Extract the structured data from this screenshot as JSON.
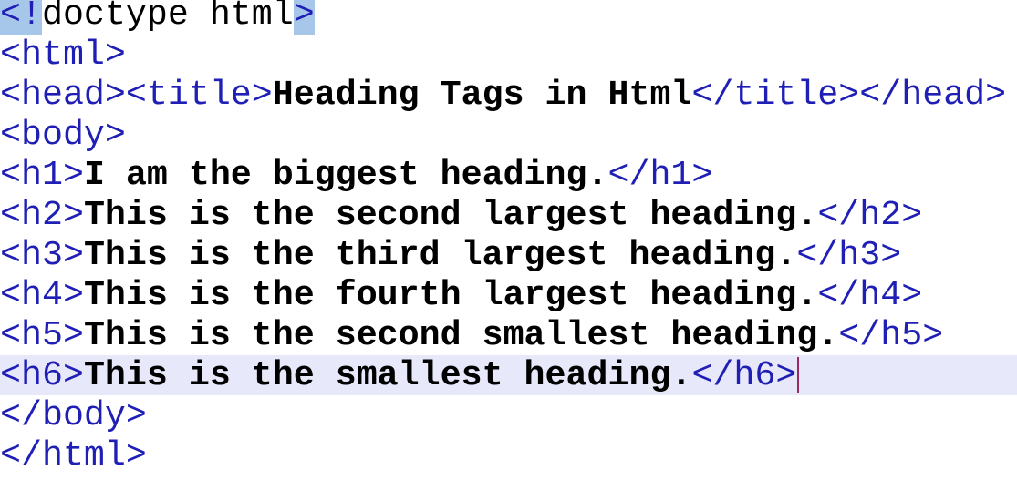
{
  "lines": [
    [
      {
        "t": "<!",
        "c": "tag",
        "hl": true
      },
      {
        "t": "doctype html",
        "c": "plain"
      },
      {
        "t": ">",
        "c": "tag",
        "hl": true
      }
    ],
    [
      {
        "t": "<html>",
        "c": "tag"
      }
    ],
    [
      {
        "t": "<head><title>",
        "c": "tag"
      },
      {
        "t": "Heading Tags in Html",
        "c": "txt"
      },
      {
        "t": "</title></head>",
        "c": "tag"
      }
    ],
    [
      {
        "t": "<body>",
        "c": "tag"
      }
    ],
    [
      {
        "t": "<h1>",
        "c": "tag"
      },
      {
        "t": "I am the biggest heading.",
        "c": "txt"
      },
      {
        "t": "</h1>",
        "c": "tag"
      }
    ],
    [
      {
        "t": "<h2>",
        "c": "tag"
      },
      {
        "t": "This is the second largest heading.",
        "c": "txt"
      },
      {
        "t": "</h2>",
        "c": "tag"
      }
    ],
    [
      {
        "t": "<h3>",
        "c": "tag"
      },
      {
        "t": "This is the third largest heading.",
        "c": "txt"
      },
      {
        "t": "</h3>",
        "c": "tag"
      }
    ],
    [
      {
        "t": "<h4>",
        "c": "tag"
      },
      {
        "t": "This is the fourth largest heading.",
        "c": "txt"
      },
      {
        "t": "</h4>",
        "c": "tag"
      }
    ],
    [
      {
        "t": "<h5>",
        "c": "tag"
      },
      {
        "t": "This is the second smallest heading.",
        "c": "txt"
      },
      {
        "t": "</h5>",
        "c": "tag"
      }
    ],
    [
      {
        "t": "<h6>",
        "c": "tag"
      },
      {
        "t": "This is the smallest heading.",
        "c": "txt"
      },
      {
        "t": "</h6>",
        "c": "tag"
      }
    ],
    [
      {
        "t": "</body>",
        "c": "tag"
      }
    ],
    [
      {
        "t": "</html>",
        "c": "tag"
      }
    ]
  ],
  "current_line": 10,
  "colors": {
    "tag": "#1f1fb6",
    "text": "#000000",
    "current_line_bg": "#e8e8fb",
    "match_highlight": "#a7c7ea",
    "caret": "#9b2a60"
  }
}
